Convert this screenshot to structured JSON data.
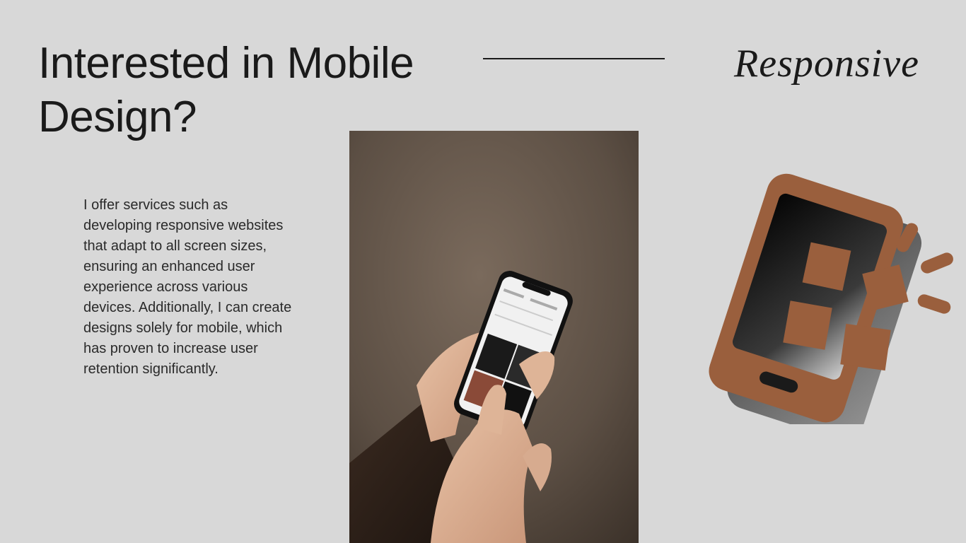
{
  "header": {
    "title": "Interested in Mobile Design?",
    "tagline": "Responsive"
  },
  "main": {
    "description": "I offer services such as developing responsive websites that adapt to all screen sizes, ensuring an enhanced user experience across various devices. Additionally, I can create designs solely for mobile, which has proven to increase user retention significantly."
  },
  "icons": {
    "illustration": "responsive-phone-icon"
  },
  "colors": {
    "background": "#d8d8d8",
    "accent": "#9a5f3d",
    "text": "#1a1a1a"
  }
}
